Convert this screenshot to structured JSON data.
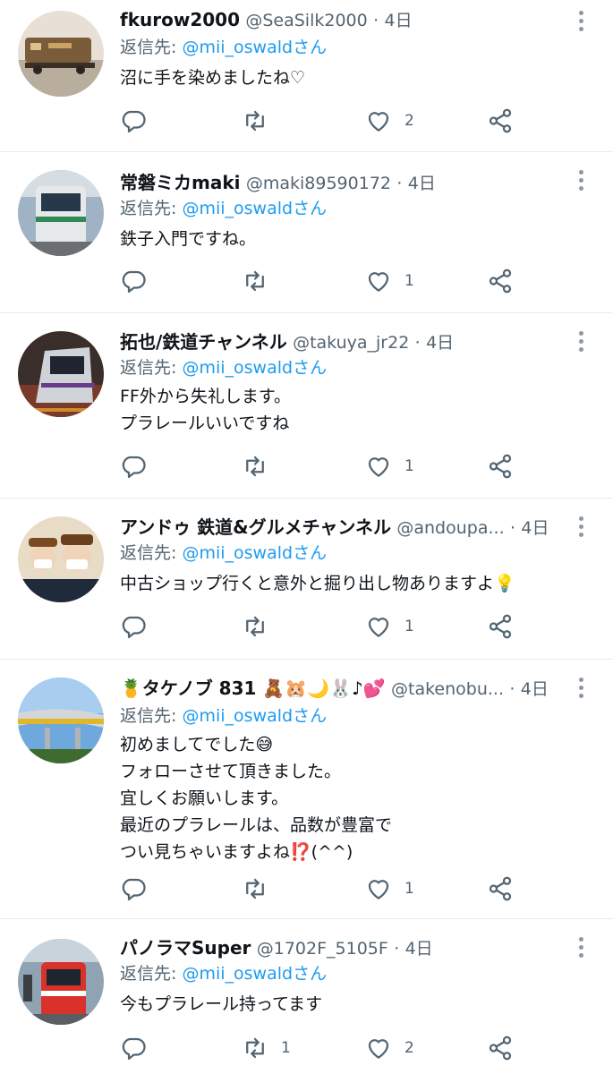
{
  "tweets": [
    {
      "name": "fkurow2000",
      "handle": "@SeaSilk2000",
      "dot": "·",
      "time": "4日",
      "reply_label": "返信先: ",
      "reply_user": "@mii_oswaldさん",
      "lines": [
        "沼に手を染めましたね♡"
      ],
      "replies": "",
      "retweets": "",
      "likes": "2"
    },
    {
      "name": "常磐ミカmaki",
      "handle": "@maki89590172",
      "dot": "·",
      "time": "4日",
      "reply_label": "返信先: ",
      "reply_user": "@mii_oswaldさん",
      "lines": [
        "鉄子入門ですね。"
      ],
      "replies": "",
      "retweets": "",
      "likes": "1"
    },
    {
      "name": "拓也/鉄道チャンネル",
      "handle": "@takuya_jr22",
      "dot": "·",
      "time": "4日",
      "reply_label": "返信先: ",
      "reply_user": "@mii_oswaldさん",
      "lines": [
        "FF外から失礼します。",
        "プラレールいいですね"
      ],
      "replies": "",
      "retweets": "",
      "likes": "1"
    },
    {
      "name": "アンドゥ 鉄道&グルメチャンネル",
      "handle": "@andoupa...",
      "dot": "·",
      "time": "4日",
      "reply_label": "返信先: ",
      "reply_user": "@mii_oswaldさん",
      "lines": [
        "中古ショップ行くと意外と掘り出し物ありますよ💡"
      ],
      "replies": "",
      "retweets": "",
      "likes": "1"
    },
    {
      "name": "🍍タケノブ 831 🧸🐹🌙🐰♪💕",
      "handle": "@takenobu...",
      "dot": "·",
      "time": "4日",
      "reply_label": "返信先: ",
      "reply_user": "@mii_oswaldさん",
      "lines": [
        "初めましてでした😅",
        "フォローさせて頂きました。",
        "宜しくお願いします。",
        "最近のプラレールは、品数が豊富で",
        "つい見ちゃいますよね⁉️(^^)"
      ],
      "replies": "",
      "retweets": "",
      "likes": "1"
    },
    {
      "name": "パノラマSuper",
      "handle": "@1702F_5105F",
      "dot": "·",
      "time": "4日",
      "reply_label": "返信先: ",
      "reply_user": "@mii_oswaldさん",
      "lines": [
        "今もプラレール持ってます"
      ],
      "replies": "",
      "retweets": "1",
      "likes": "2"
    }
  ],
  "icons": {
    "reply": "reply-icon",
    "retweet": "retweet-icon",
    "like": "heart-icon",
    "share": "share-icon",
    "more": "more-options-icon"
  },
  "colors": {
    "text": "#0f1419",
    "secondary": "#536471",
    "link": "#1d9bf0",
    "divider": "#e6ecf0"
  }
}
